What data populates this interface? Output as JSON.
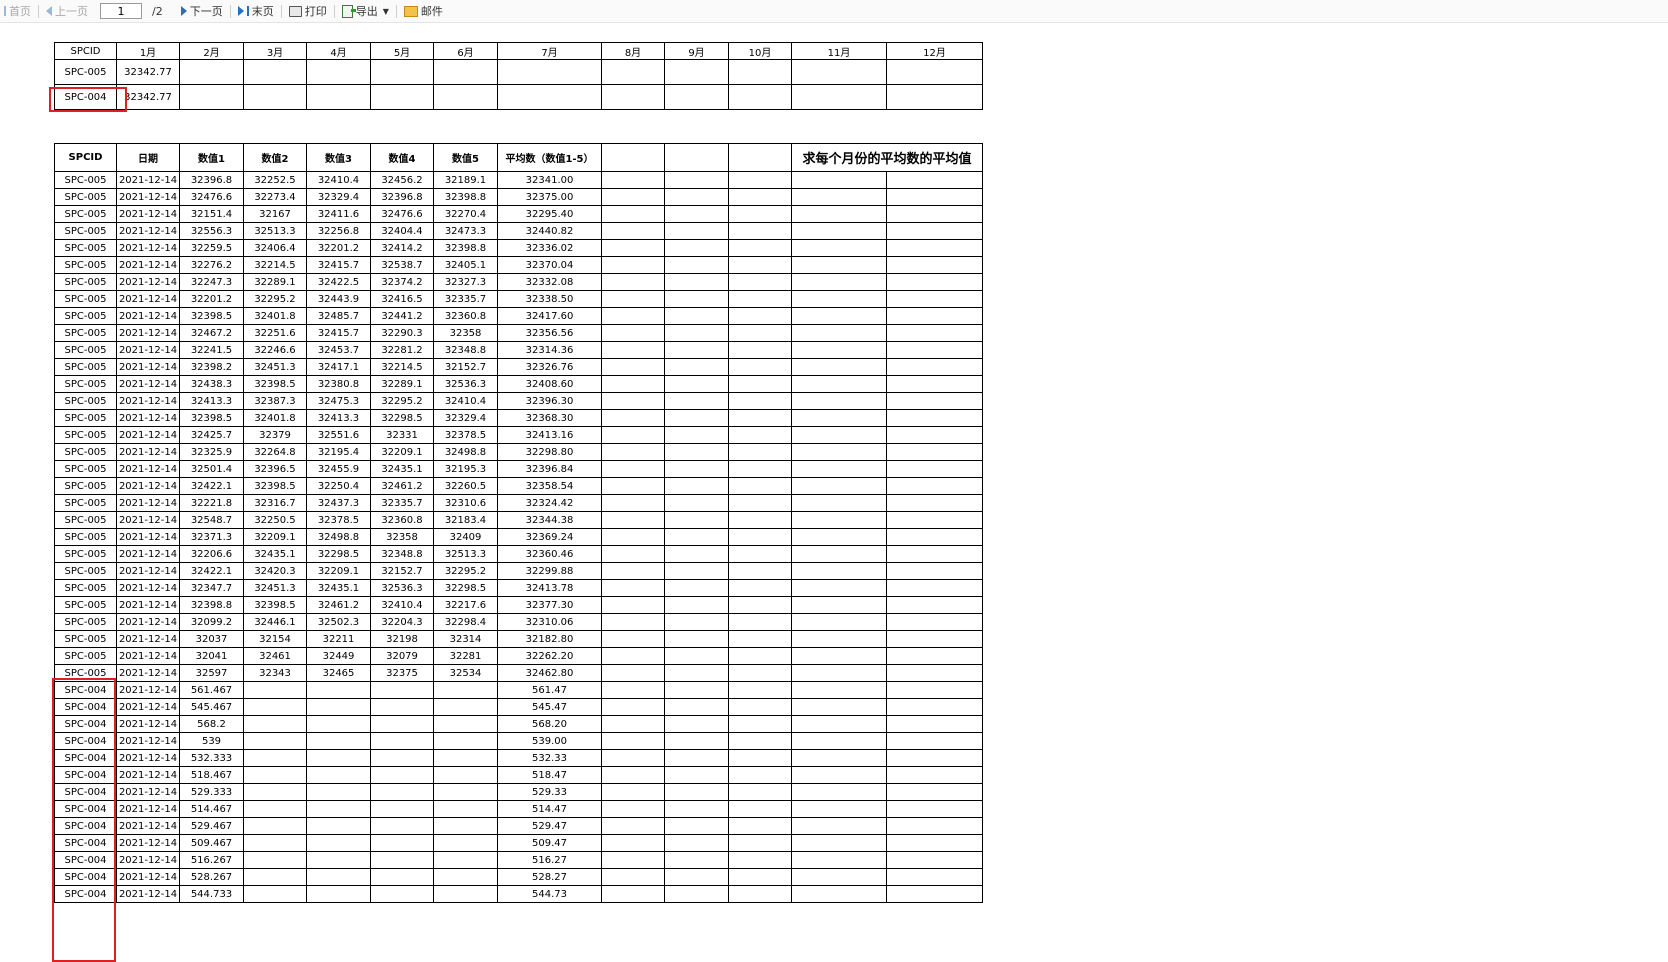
{
  "toolbar": {
    "first": "首页",
    "prev": "上一页",
    "page_value": "1",
    "page_total": "/2",
    "next": "下一页",
    "last": "末页",
    "print": "打印",
    "export": "导出",
    "mail": "邮件"
  },
  "colors": {
    "highlight": "#e02020",
    "nav_icon": "#2a6fbd"
  },
  "summary": {
    "headers": [
      "SPCID",
      "1月",
      "2月",
      "3月",
      "4月",
      "5月",
      "6月",
      "7月",
      "8月",
      "9月",
      "10月",
      "11月",
      "12月"
    ],
    "rows": [
      [
        "SPC-005",
        "32342.77",
        "",
        "",
        "",
        "",
        "",
        "",
        "",
        "",
        "",
        "",
        ""
      ],
      [
        "SPC-004",
        "32342.77",
        "",
        "",
        "",
        "",
        "",
        "",
        "",
        "",
        "",
        "",
        ""
      ]
    ]
  },
  "detail": {
    "headers": [
      "SPCID",
      "日期",
      "数值1",
      "数值2",
      "数值3",
      "数值4",
      "数值5",
      "平均数（数值1-5）",
      "",
      "",
      "",
      "求每个月份的平均数的平均值"
    ],
    "rows": [
      [
        "SPC-005",
        "2021-12-14",
        "32396.8",
        "32252.5",
        "32410.4",
        "32456.2",
        "32189.1",
        "32341.00"
      ],
      [
        "SPC-005",
        "2021-12-14",
        "32476.6",
        "32273.4",
        "32329.4",
        "32396.8",
        "32398.8",
        "32375.00"
      ],
      [
        "SPC-005",
        "2021-12-14",
        "32151.4",
        "32167",
        "32411.6",
        "32476.6",
        "32270.4",
        "32295.40"
      ],
      [
        "SPC-005",
        "2021-12-14",
        "32556.3",
        "32513.3",
        "32256.8",
        "32404.4",
        "32473.3",
        "32440.82"
      ],
      [
        "SPC-005",
        "2021-12-14",
        "32259.5",
        "32406.4",
        "32201.2",
        "32414.2",
        "32398.8",
        "32336.02"
      ],
      [
        "SPC-005",
        "2021-12-14",
        "32276.2",
        "32214.5",
        "32415.7",
        "32538.7",
        "32405.1",
        "32370.04"
      ],
      [
        "SPC-005",
        "2021-12-14",
        "32247.3",
        "32289.1",
        "32422.5",
        "32374.2",
        "32327.3",
        "32332.08"
      ],
      [
        "SPC-005",
        "2021-12-14",
        "32201.2",
        "32295.2",
        "32443.9",
        "32416.5",
        "32335.7",
        "32338.50"
      ],
      [
        "SPC-005",
        "2021-12-14",
        "32398.5",
        "32401.8",
        "32485.7",
        "32441.2",
        "32360.8",
        "32417.60"
      ],
      [
        "SPC-005",
        "2021-12-14",
        "32467.2",
        "32251.6",
        "32415.7",
        "32290.3",
        "32358",
        "32356.56"
      ],
      [
        "SPC-005",
        "2021-12-14",
        "32241.5",
        "32246.6",
        "32453.7",
        "32281.2",
        "32348.8",
        "32314.36"
      ],
      [
        "SPC-005",
        "2021-12-14",
        "32398.2",
        "32451.3",
        "32417.1",
        "32214.5",
        "32152.7",
        "32326.76"
      ],
      [
        "SPC-005",
        "2021-12-14",
        "32438.3",
        "32398.5",
        "32380.8",
        "32289.1",
        "32536.3",
        "32408.60"
      ],
      [
        "SPC-005",
        "2021-12-14",
        "32413.3",
        "32387.3",
        "32475.3",
        "32295.2",
        "32410.4",
        "32396.30"
      ],
      [
        "SPC-005",
        "2021-12-14",
        "32398.5",
        "32401.8",
        "32413.3",
        "32298.5",
        "32329.4",
        "32368.30"
      ],
      [
        "SPC-005",
        "2021-12-14",
        "32425.7",
        "32379",
        "32551.6",
        "32331",
        "32378.5",
        "32413.16"
      ],
      [
        "SPC-005",
        "2021-12-14",
        "32325.9",
        "32264.8",
        "32195.4",
        "32209.1",
        "32498.8",
        "32298.80"
      ],
      [
        "SPC-005",
        "2021-12-14",
        "32501.4",
        "32396.5",
        "32455.9",
        "32435.1",
        "32195.3",
        "32396.84"
      ],
      [
        "SPC-005",
        "2021-12-14",
        "32422.1",
        "32398.5",
        "32250.4",
        "32461.2",
        "32260.5",
        "32358.54"
      ],
      [
        "SPC-005",
        "2021-12-14",
        "32221.8",
        "32316.7",
        "32437.3",
        "32335.7",
        "32310.6",
        "32324.42"
      ],
      [
        "SPC-005",
        "2021-12-14",
        "32548.7",
        "32250.5",
        "32378.5",
        "32360.8",
        "32183.4",
        "32344.38"
      ],
      [
        "SPC-005",
        "2021-12-14",
        "32371.3",
        "32209.1",
        "32498.8",
        "32358",
        "32409",
        "32369.24"
      ],
      [
        "SPC-005",
        "2021-12-14",
        "32206.6",
        "32435.1",
        "32298.5",
        "32348.8",
        "32513.3",
        "32360.46"
      ],
      [
        "SPC-005",
        "2021-12-14",
        "32422.1",
        "32420.3",
        "32209.1",
        "32152.7",
        "32295.2",
        "32299.88"
      ],
      [
        "SPC-005",
        "2021-12-14",
        "32347.7",
        "32451.3",
        "32435.1",
        "32536.3",
        "32298.5",
        "32413.78"
      ],
      [
        "SPC-005",
        "2021-12-14",
        "32398.8",
        "32398.5",
        "32461.2",
        "32410.4",
        "32217.6",
        "32377.30"
      ],
      [
        "SPC-005",
        "2021-12-14",
        "32099.2",
        "32446.1",
        "32502.3",
        "32204.3",
        "32298.4",
        "32310.06"
      ],
      [
        "SPC-005",
        "2021-12-14",
        "32037",
        "32154",
        "32211",
        "32198",
        "32314",
        "32182.80"
      ],
      [
        "SPC-005",
        "2021-12-14",
        "32041",
        "32461",
        "32449",
        "32079",
        "32281",
        "32262.20"
      ],
      [
        "SPC-005",
        "2021-12-14",
        "32597",
        "32343",
        "32465",
        "32375",
        "32534",
        "32462.80"
      ],
      [
        "SPC-004",
        "2021-12-14",
        "561.467",
        "",
        "",
        "",
        "",
        "561.47"
      ],
      [
        "SPC-004",
        "2021-12-14",
        "545.467",
        "",
        "",
        "",
        "",
        "545.47"
      ],
      [
        "SPC-004",
        "2021-12-14",
        "568.2",
        "",
        "",
        "",
        "",
        "568.20"
      ],
      [
        "SPC-004",
        "2021-12-14",
        "539",
        "",
        "",
        "",
        "",
        "539.00"
      ],
      [
        "SPC-004",
        "2021-12-14",
        "532.333",
        "",
        "",
        "",
        "",
        "532.33"
      ],
      [
        "SPC-004",
        "2021-12-14",
        "518.467",
        "",
        "",
        "",
        "",
        "518.47"
      ],
      [
        "SPC-004",
        "2021-12-14",
        "529.333",
        "",
        "",
        "",
        "",
        "529.33"
      ],
      [
        "SPC-004",
        "2021-12-14",
        "514.467",
        "",
        "",
        "",
        "",
        "514.47"
      ],
      [
        "SPC-004",
        "2021-12-14",
        "529.467",
        "",
        "",
        "",
        "",
        "529.47"
      ],
      [
        "SPC-004",
        "2021-12-14",
        "509.467",
        "",
        "",
        "",
        "",
        "509.47"
      ],
      [
        "SPC-004",
        "2021-12-14",
        "516.267",
        "",
        "",
        "",
        "",
        "516.27"
      ],
      [
        "SPC-004",
        "2021-12-14",
        "528.267",
        "",
        "",
        "",
        "",
        "528.27"
      ],
      [
        "SPC-004",
        "2021-12-14",
        "544.733",
        "",
        "",
        "",
        "",
        "544.73"
      ]
    ]
  }
}
